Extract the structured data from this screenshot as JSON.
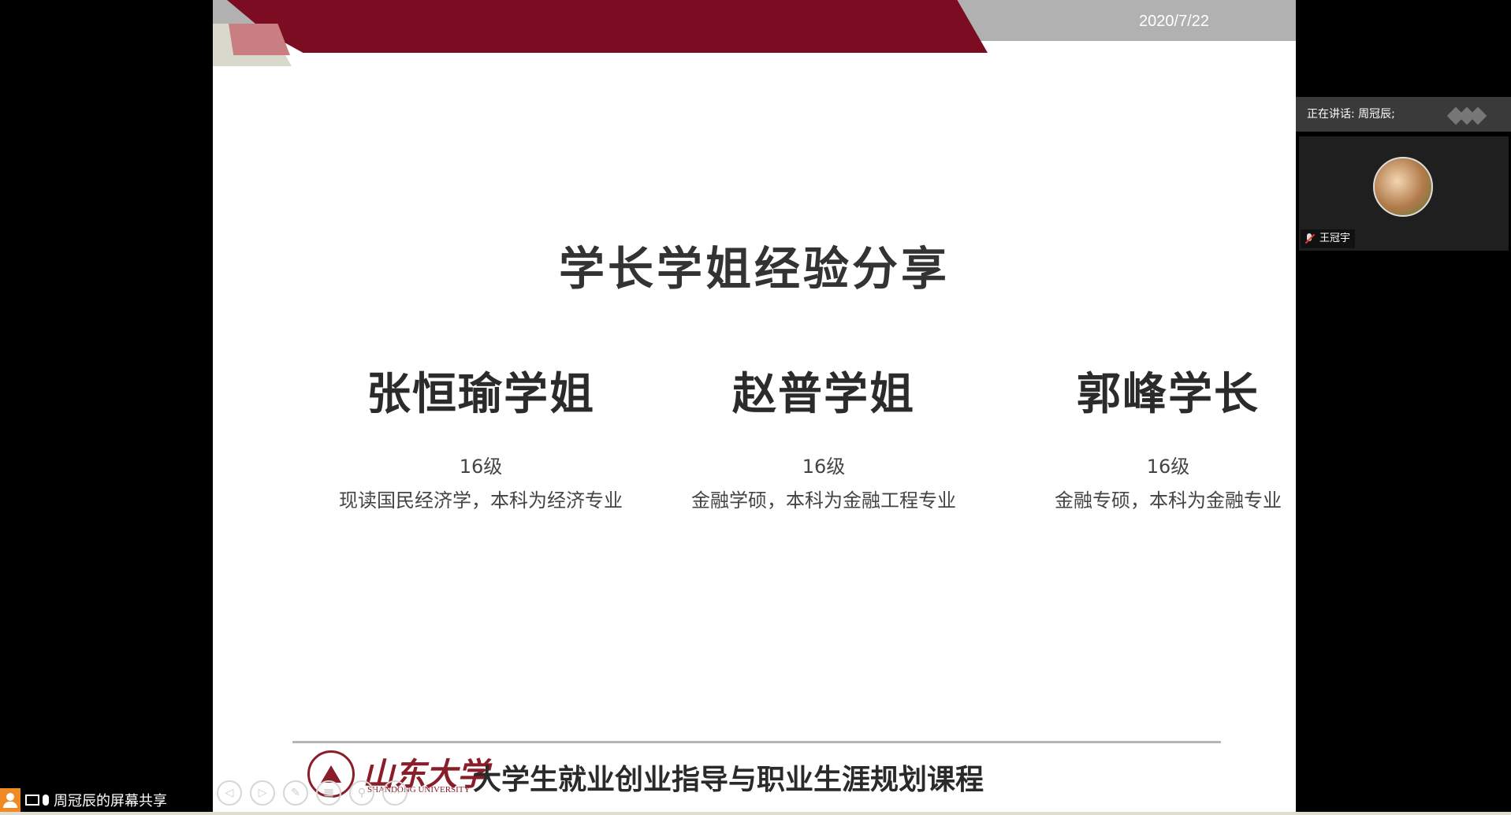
{
  "slide": {
    "date": "2020/7/22",
    "title": "学长学姐经验分享",
    "people": [
      {
        "name": "张恒瑜学姐",
        "grade": "16级",
        "desc": "现读国民经济学，本科为经济专业"
      },
      {
        "name": "赵普学姐",
        "grade": "16级",
        "desc": "金融学硕，本科为金融工程专业"
      },
      {
        "name": "郭峰学长",
        "grade": "16级",
        "desc": "金融专硕，本科为金融专业"
      }
    ],
    "footer": {
      "logo_cn": "山东大学",
      "logo_en": "SHANDONG UNIVERSITY",
      "course": "大学生就业创业指导与职业生涯规划课程"
    },
    "controls": [
      "prev-icon",
      "next-icon",
      "pen-icon",
      "slides-icon",
      "zoom-icon",
      "more-icon"
    ]
  },
  "meeting": {
    "speaking": "正在讲话: 周冠辰;",
    "participant_name": "王冠宇",
    "share_label": "周冠辰的屏幕共享"
  },
  "colors": {
    "accent_red": "#7b0c22",
    "top_gray": "#b1b1b1",
    "panel_bg": "#3a3a3a"
  }
}
